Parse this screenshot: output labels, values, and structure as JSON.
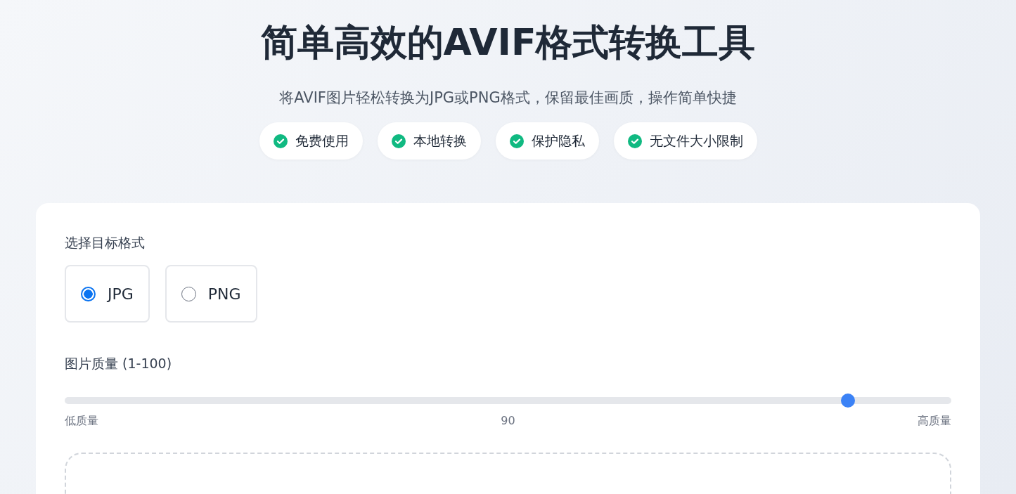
{
  "title": "简单高效的AVIF格式转换工具",
  "subtitle": "将AVIF图片轻松转换为JPG或PNG格式，保留最佳画质，操作简单快捷",
  "features": [
    "免费使用",
    "本地转换",
    "保护隐私",
    "无文件大小限制"
  ],
  "format": {
    "label": "选择目标格式",
    "options": [
      {
        "label": "JPG",
        "selected": true
      },
      {
        "label": "PNG",
        "selected": false
      }
    ]
  },
  "quality": {
    "label": "图片质量 (1-100)",
    "level": 0.89,
    "min_label": "低质量",
    "value": "90",
    "max_label": "高质量"
  }
}
